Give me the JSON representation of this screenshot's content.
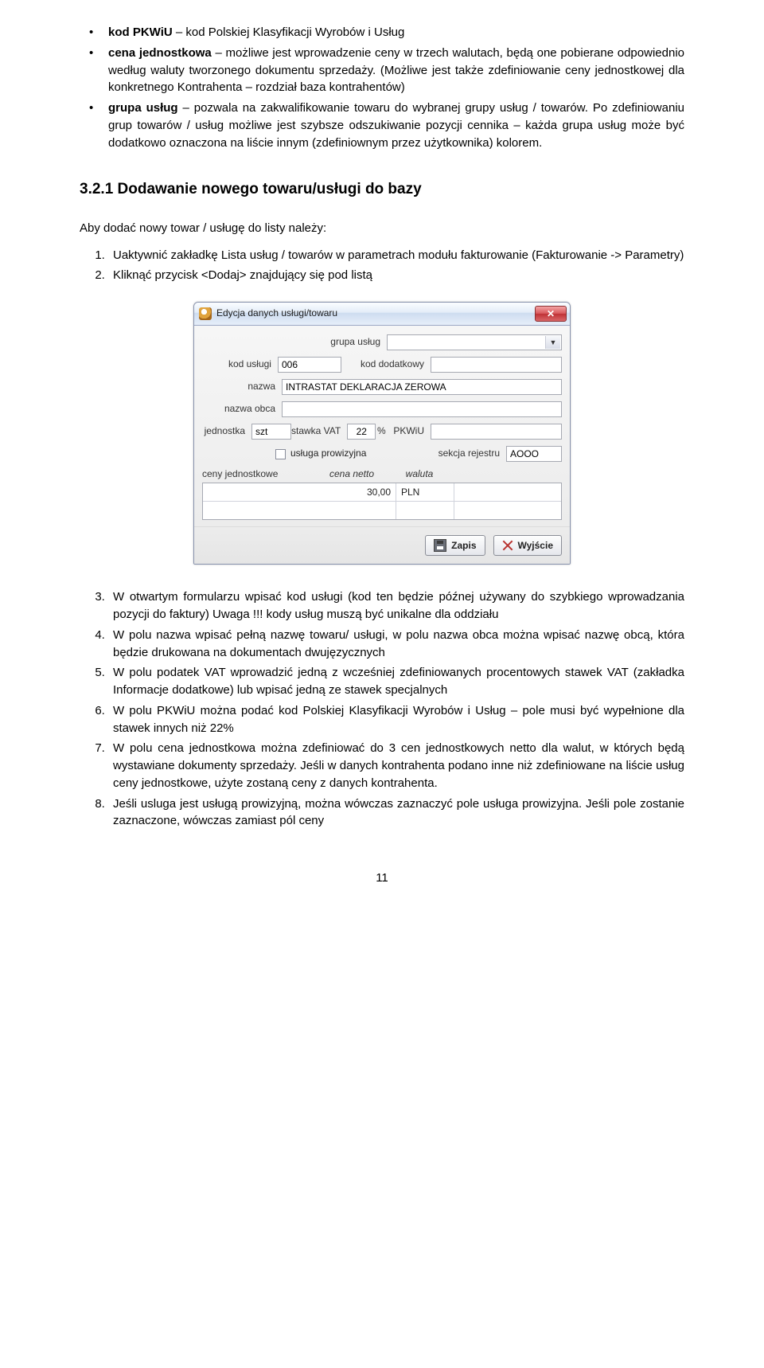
{
  "bullets_top": [
    {
      "bold": "kod PKWiU",
      "rest": " – kod Polskiej Klasyfikacji Wyrobów i Usług"
    },
    {
      "bold": "cena jednostkowa",
      "rest": " – możliwe jest wprowadzenie ceny w trzech walutach, będą one pobierane odpowiednio według waluty tworzonego dokumentu sprzedaży. (Możliwe jest także zdefiniowanie ceny jednostkowej dla konkretnego Kontrahenta – rozdział baza kontrahentów)"
    },
    {
      "bold": "grupa usług",
      "rest": " – pozwala na zakwalifikowanie towaru do wybranej grupy usług / towarów. Po zdefiniowaniu grup towarów / usług możliwe jest szybsze odszukiwanie pozycji cennika – każda grupa usług może być dodatkowo oznaczona na liście innym (zdefiniownym przez użytkownika) kolorem."
    }
  ],
  "section_title": "3.2.1 Dodawanie nowego towaru/usługi do bazy",
  "lead": "Aby dodać nowy towar / usługę do listy należy:",
  "steps_before": [
    "Uaktywnić zakładkę Lista usług / towarów w parametrach modułu fakturowanie (Fakturowanie -> Parametry)",
    "Kliknąć przycisk <Dodaj> znajdujący się pod listą"
  ],
  "dlg": {
    "title": "Edycja danych usługi/towaru",
    "labels": {
      "grupa": "grupa usług",
      "kod": "kod usługi",
      "kod_dod": "kod dodatkowy",
      "nazwa": "nazwa",
      "nazwa_obca": "nazwa obca",
      "jednostka": "jednostka",
      "stawka": "stawka VAT",
      "percent": "%",
      "pkwiu": "PKWiU",
      "prowizyjna": "usługa prowizyjna",
      "sekcja": "sekcja rejestru",
      "ceny": "ceny jednostkowe",
      "cena_netto": "cena netto",
      "waluta": "waluta"
    },
    "values": {
      "kod": "006",
      "nazwa": "INTRASTAT DEKLARACJA ZEROWA",
      "jednostka": "szt",
      "stawka": "22",
      "sekcja": "AOOO",
      "price_netto": "30,00",
      "price_waluta": "PLN"
    },
    "buttons": {
      "save": "Zapis",
      "exit": "Wyjście"
    }
  },
  "steps_after": [
    "W otwartym formularzu wpisać kod usługi (kod ten będzie późnej używany do szybkiego wprowadzania pozycji do faktury) Uwaga !!! kody usług muszą być unikalne dla oddziału",
    "W polu nazwa wpisać pełną nazwę towaru/ usługi, w polu nazwa obca można wpisać nazwę obcą, która będzie drukowana na dokumentach dwujęzycznych",
    "W polu podatek VAT wprowadzić jedną z wcześniej zdefiniowanych procentowych stawek VAT (zakładka Informacje dodatkowe) lub wpisać jedną ze stawek specjalnych",
    "W polu PKWiU można podać kod Polskiej Klasyfikacji Wyrobów i Usług – pole musi być wypełnione dla stawek innych niż 22%",
    "W polu cena jednostkowa można zdefiniować do 3 cen jednostkowych netto dla walut, w których będą wystawiane dokumenty sprzedaży. Jeśli w danych kontrahenta podano inne niż zdefiniowane na liście usług ceny jednostkowe, użyte zostaną ceny z danych kontrahenta.",
    "Jeśli usluga jest usługą prowizyjną, można wówczas zaznaczyć pole usługa prowizyjna. Jeśli pole zostanie zaznaczone, wówczas zamiast pól ceny"
  ],
  "page_number": "11"
}
